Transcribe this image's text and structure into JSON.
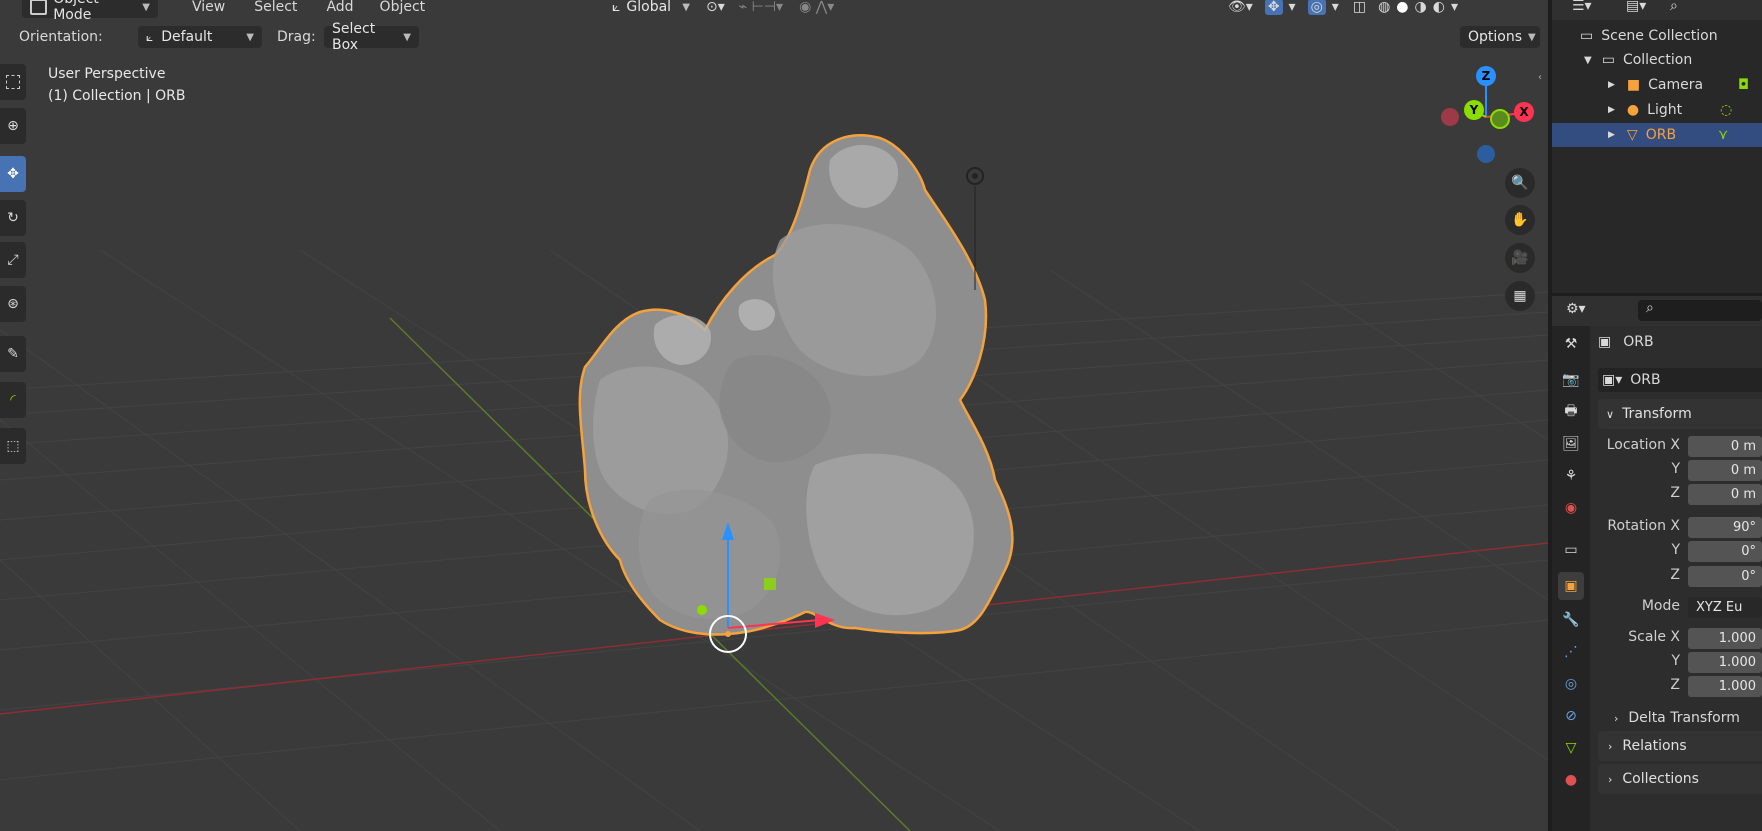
{
  "header": {
    "mode_label": "Object Mode",
    "menu": [
      "View",
      "Select",
      "Add",
      "Object"
    ],
    "transform_space": "Global"
  },
  "tool_settings": {
    "orientation_label": "Orientation:",
    "orientation_value": "Default",
    "drag_label": "Drag:",
    "drag_value": "Select Box",
    "options_label": "Options"
  },
  "viewport": {
    "perspective_label": "User Perspective",
    "collection_label": "(1) Collection | ORB"
  },
  "gizmo": {
    "z": "Z",
    "y": "Y",
    "x": "X"
  },
  "outliner": {
    "root": "Scene Collection",
    "collection": "Collection",
    "items": [
      "Camera",
      "Light",
      "ORB"
    ]
  },
  "properties": {
    "object_name": "ORB",
    "datablock_name": "ORB",
    "transform_header": "Transform",
    "location_label": "Location X",
    "y_label": "Y",
    "z_label": "Z",
    "rotation_label": "Rotation X",
    "mode_label": "Mode",
    "scale_label": "Scale X",
    "location_values": [
      "0 m",
      "0 m",
      "0 m"
    ],
    "rotation_values": [
      "90°",
      "0°",
      "0°"
    ],
    "mode_value": "XYZ Eu",
    "scale_values": [
      "1.000",
      "1.000",
      "1.000"
    ],
    "delta_label": "Delta Transform",
    "relations_label": "Relations",
    "collections_label": "Collections"
  },
  "colors": {
    "accent_blue": "#4772b3",
    "selection_orange": "#f5a13c",
    "axis_x": "#ff3352",
    "axis_y": "#8bdc00",
    "axis_z": "#2890ff"
  }
}
